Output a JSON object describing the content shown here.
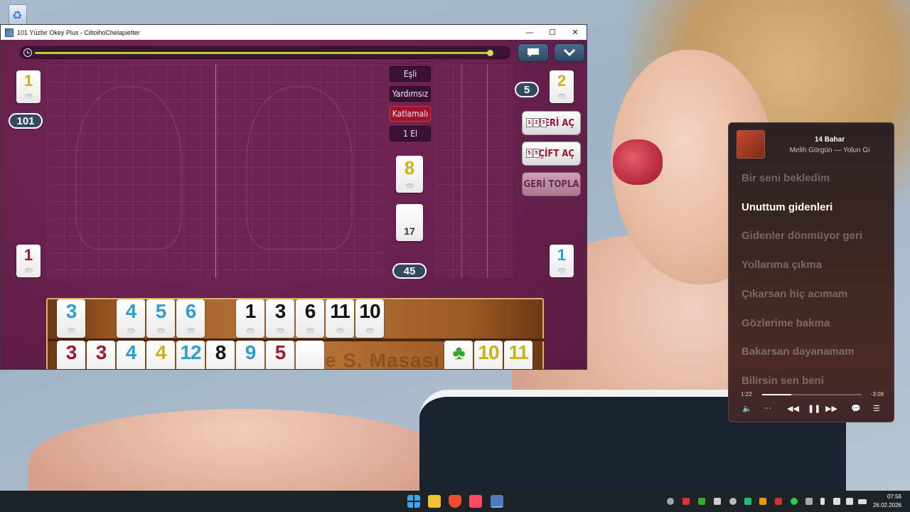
{
  "window": {
    "title": "101 Yüzbir Okey Plus - CiltoihoChelapietter",
    "minimize_glyph": "—",
    "maximize_glyph": "☐",
    "close_glyph": "✕"
  },
  "game": {
    "timer_progress": 0.97,
    "icons": {
      "chat": "chat-icon",
      "menu": "chevron-down-icon",
      "timer": "clock-icon"
    },
    "modes": [
      "Eşli",
      "Yardımsız",
      "Katlamalı",
      "1 El"
    ],
    "active_mode_index": 2,
    "indicator_tile": {
      "number": "8",
      "color": "#c9b31a"
    },
    "draw_pile_count": "17",
    "remaining_count": "45",
    "left_player": {
      "top_tile": "1",
      "top_color": "#c9b31a",
      "score": "101",
      "bottom_tile": "1",
      "bottom_color": "#a31830"
    },
    "right_player": {
      "badge": "5",
      "top_tile": "2",
      "top_color": "#c9b31a",
      "bottom_tile": "1",
      "bottom_color": "#2a9fd0"
    },
    "buttons": {
      "seri_ac": "SERİ AÇ",
      "cift_ac": "ÇİFT AÇ",
      "geri_topla": "GERİ TOPLA"
    },
    "rack_engraving": "e S. Masası",
    "rack_top": [
      {
        "n": "3",
        "c": "blue"
      },
      {
        "n": "4",
        "c": "blue"
      },
      {
        "n": "5",
        "c": "blue"
      },
      {
        "n": "6",
        "c": "blue"
      },
      {
        "n": "1",
        "c": "black"
      },
      {
        "n": "3",
        "c": "black"
      },
      {
        "n": "6",
        "c": "black"
      },
      {
        "n": "11",
        "c": "black"
      },
      {
        "n": "10",
        "c": "black"
      }
    ],
    "rack_bottom": [
      {
        "n": "3",
        "c": "red"
      },
      {
        "n": "3",
        "c": "red"
      },
      {
        "n": "4",
        "c": "blue"
      },
      {
        "n": "4",
        "c": "yellow"
      },
      {
        "n": "12",
        "c": "blue"
      },
      {
        "n": "8",
        "c": "black"
      },
      {
        "n": "9",
        "c": "blue"
      },
      {
        "n": "5",
        "c": "red"
      },
      {
        "n": "",
        "c": "black"
      },
      {
        "n": "♣",
        "c": "green"
      },
      {
        "n": "10",
        "c": "yellow"
      },
      {
        "n": "11",
        "c": "yellow"
      }
    ]
  },
  "music": {
    "title": "14 Bahar",
    "artist": "Melih Görgün — Yolun Gi",
    "lyrics": [
      "Bir seni bekledim",
      "Unuttum gidenleri",
      "Gidenler dönmüyor geri",
      "Yollarıma çıkma",
      "Çıkarsan hiç acımam",
      "Gözlerime bakma",
      "Bakarsan dayanamam",
      "Bilirsin sen beni"
    ],
    "current_lyric_index": 1,
    "elapsed": "1:22",
    "remaining": "-3:09",
    "progress": 0.29,
    "controls": {
      "volume": "🔈",
      "more": "···",
      "rewind": "◀◀",
      "pause": "❚❚",
      "forward": "▶▶",
      "lyrics": "💬",
      "queue": "☰"
    }
  },
  "taskbar": {
    "time": "07:56",
    "date": "26.02.2026",
    "apps": [
      "start-icon",
      "file-explorer-icon",
      "brave-browser-icon",
      "music-app-icon",
      "okey-game-icon"
    ]
  }
}
